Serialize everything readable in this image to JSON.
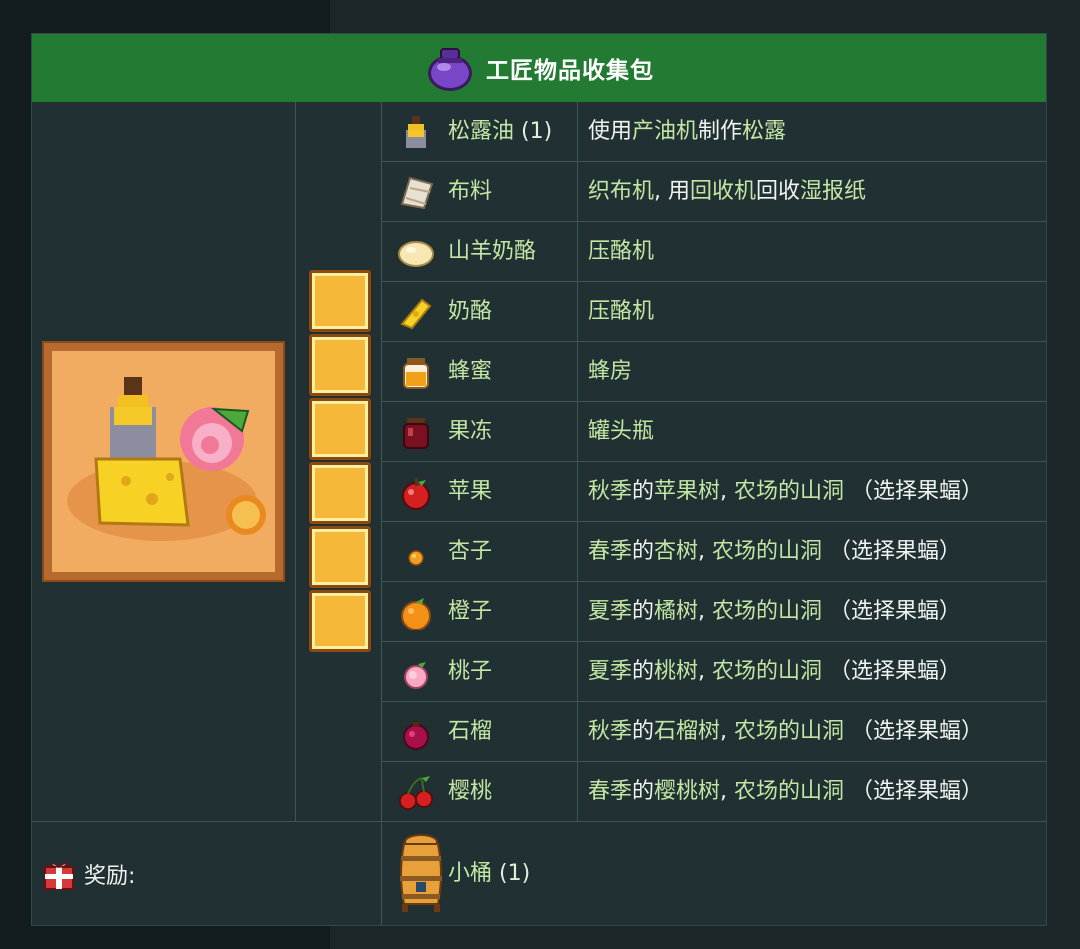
{
  "bundle": {
    "title": "工匠物品收集包",
    "icon": "purple-bundle-icon",
    "slot_count": 6,
    "items": [
      {
        "name": "松露油",
        "qty": " (1)",
        "icon": "truffle-oil-icon",
        "source": [
          {
            "t": "使用",
            "h": false
          },
          {
            "t": "产油机",
            "h": true
          },
          {
            "t": "制作",
            "h": false
          },
          {
            "t": "松露",
            "h": true
          }
        ]
      },
      {
        "name": "布料",
        "qty": "",
        "icon": "cloth-icon",
        "source": [
          {
            "t": "织布机",
            "h": true
          },
          {
            "t": ", 用",
            "h": false
          },
          {
            "t": "回收机",
            "h": true
          },
          {
            "t": "回收",
            "h": false
          },
          {
            "t": "湿报纸",
            "h": true
          }
        ]
      },
      {
        "name": "山羊奶酪",
        "qty": "",
        "icon": "goat-cheese-icon",
        "source": [
          {
            "t": "压酪机",
            "h": true
          }
        ]
      },
      {
        "name": "奶酪",
        "qty": "",
        "icon": "cheese-icon",
        "source": [
          {
            "t": "压酪机",
            "h": true
          }
        ]
      },
      {
        "name": "蜂蜜",
        "qty": "",
        "icon": "honey-icon",
        "source": [
          {
            "t": "蜂房",
            "h": true
          }
        ]
      },
      {
        "name": "果冻",
        "qty": "",
        "icon": "jelly-icon",
        "source": [
          {
            "t": "罐头瓶",
            "h": true
          }
        ]
      },
      {
        "name": "苹果",
        "qty": "",
        "icon": "apple-icon",
        "source": [
          {
            "t": "秋季",
            "h": true
          },
          {
            "t": "的",
            "h": false
          },
          {
            "t": "苹果树",
            "h": true
          },
          {
            "t": ", ",
            "h": false
          },
          {
            "t": "农场的山洞",
            "h": true
          },
          {
            "t": " （选择果蝠）",
            "h": false
          }
        ]
      },
      {
        "name": "杏子",
        "qty": "",
        "icon": "apricot-icon",
        "source": [
          {
            "t": "春季",
            "h": true
          },
          {
            "t": "的",
            "h": false
          },
          {
            "t": "杏树",
            "h": true
          },
          {
            "t": ", ",
            "h": false
          },
          {
            "t": "农场的山洞",
            "h": true
          },
          {
            "t": " （选择果蝠）",
            "h": false
          }
        ]
      },
      {
        "name": "橙子",
        "qty": "",
        "icon": "orange-icon",
        "source": [
          {
            "t": "夏季",
            "h": true
          },
          {
            "t": "的",
            "h": false
          },
          {
            "t": "橘树",
            "h": true
          },
          {
            "t": ", ",
            "h": false
          },
          {
            "t": "农场的山洞",
            "h": true
          },
          {
            "t": " （选择果蝠）",
            "h": false
          }
        ]
      },
      {
        "name": "桃子",
        "qty": "",
        "icon": "peach-icon",
        "source": [
          {
            "t": "夏季",
            "h": true
          },
          {
            "t": "的",
            "h": false
          },
          {
            "t": "桃树",
            "h": true
          },
          {
            "t": ", ",
            "h": false
          },
          {
            "t": "农场的山洞",
            "h": true
          },
          {
            "t": " （选择果蝠）",
            "h": false
          }
        ]
      },
      {
        "name": "石榴",
        "qty": "",
        "icon": "pomegranate-icon",
        "source": [
          {
            "t": "秋季",
            "h": true
          },
          {
            "t": "的",
            "h": false
          },
          {
            "t": "石榴树",
            "h": true
          },
          {
            "t": ", ",
            "h": false
          },
          {
            "t": "农场的山洞",
            "h": true
          },
          {
            "t": " （选择果蝠）",
            "h": false
          }
        ]
      },
      {
        "name": "樱桃",
        "qty": "",
        "icon": "cherry-icon",
        "source": [
          {
            "t": "春季",
            "h": true
          },
          {
            "t": "的",
            "h": false
          },
          {
            "t": "樱桃树",
            "h": true
          },
          {
            "t": ", ",
            "h": false
          },
          {
            "t": "农场的山洞",
            "h": true
          },
          {
            "t": " （选择果蝠）",
            "h": false
          }
        ]
      }
    ],
    "reward": {
      "label": "奖励:",
      "icon": "gift-icon",
      "item_name": "小桶",
      "item_qty": " (1)",
      "item_icon": "keg-icon"
    }
  },
  "colors": {
    "header_green": "#237a32",
    "link_green": "#c3e6a4",
    "panel": "#213032",
    "slot_gold": "#f6b838"
  }
}
